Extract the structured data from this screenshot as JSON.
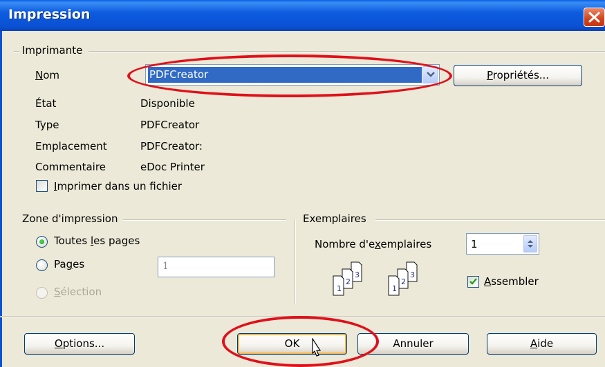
{
  "window": {
    "title": "Impression"
  },
  "printer": {
    "group_label": "Imprimante",
    "name_label": "Nom",
    "name_value": "PDFCreator",
    "properties_button": "Propriétés...",
    "status_label": "État",
    "status_value": "Disponible",
    "type_label": "Type",
    "type_value": "PDFCreator",
    "location_label": "Emplacement",
    "location_value": "PDFCreator:",
    "comment_label": "Commentaire",
    "comment_value": "eDoc Printer",
    "print_to_file_label": "Imprimer dans un fichier",
    "print_to_file_checked": false
  },
  "print_range": {
    "group_label": "Zone d'impression",
    "all_pages_label": "Toutes les pages",
    "pages_label": "Pages",
    "pages_value": "1",
    "selection_label": "Sélection",
    "selected": "all_pages"
  },
  "copies": {
    "group_label": "Exemplaires",
    "count_label": "Nombre d'exemplaires",
    "count_value": "1",
    "collate_label": "Assembler",
    "collate_checked": true,
    "collate_icon_pages": [
      "1",
      "2",
      "3"
    ]
  },
  "footer": {
    "options_button": "Options...",
    "ok_button": "OK",
    "cancel_button": "Annuler",
    "help_button": "Aide"
  },
  "icons": [
    "close-icon",
    "dropdown-arrow-icon",
    "spinner-icon",
    "collate-pages-icon",
    "mouse-cursor-icon"
  ],
  "colors": {
    "titlebar": "#0a50d4",
    "selection": "#316ac5",
    "annotation": "#e0101a",
    "dialog_bg": "#ece9d8"
  }
}
